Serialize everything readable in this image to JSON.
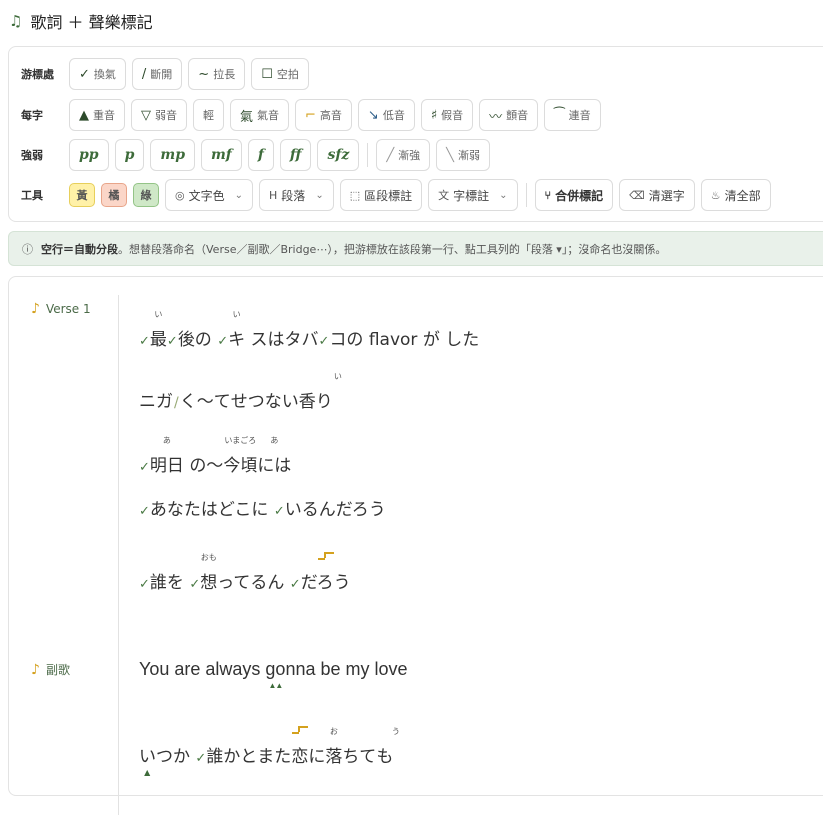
{
  "header": {
    "title": "歌詞 ＋ 聲樂標記"
  },
  "toolbar": {
    "row_breath": {
      "label": "游標處",
      "buttons": [
        {
          "glyph": "✓",
          "label": "換氣",
          "icon": "check-icon"
        },
        {
          "glyph": "/",
          "label": "斷開",
          "icon": "slash-icon"
        },
        {
          "glyph": "~",
          "label": "拉長",
          "icon": "tilde-icon"
        },
        {
          "glyph": "☐",
          "label": "空拍",
          "icon": "square-icon"
        }
      ]
    },
    "row_char": {
      "label": "每字",
      "buttons": [
        {
          "glyph": "▲",
          "label": "重音",
          "icon": "triangle-up-icon"
        },
        {
          "glyph": "▽",
          "label": "弱音",
          "icon": "triangle-down-icon"
        },
        {
          "glyph": "",
          "label": "輕",
          "icon": ""
        },
        {
          "glyph": "氣",
          "label": "氣音",
          "icon": "breath-char-icon"
        },
        {
          "glyph": "⌐",
          "label": "高音",
          "icon": "step-up-icon"
        },
        {
          "glyph": "↘",
          "label": "低音",
          "icon": "step-down-icon"
        },
        {
          "glyph": "♯",
          "label": "假音",
          "icon": "falsetto-icon"
        },
        {
          "glyph": "〰",
          "label": "顫音",
          "icon": "vibrato-icon"
        },
        {
          "glyph": "⁀",
          "label": "連音",
          "icon": "slur-icon"
        }
      ]
    },
    "row_dynamics": {
      "label": "強弱",
      "dynamics": [
        "pp",
        "p",
        "mp",
        "mf",
        "f",
        "ff",
        "sfz"
      ],
      "crescendo": {
        "glyph": "╱",
        "label": "漸強"
      },
      "decrescendo": {
        "glyph": "╲",
        "label": "漸弱"
      }
    },
    "row_tools": {
      "label": "工具",
      "chips": [
        {
          "label": "黃",
          "bg": "#fff1a8",
          "border": "#e7cf5b"
        },
        {
          "label": "橘",
          "bg": "#fbd6c8",
          "border": "#e8a58a"
        },
        {
          "label": "綠",
          "bg": "#cfe8c7",
          "border": "#94c487"
        }
      ],
      "text_color": "文字色",
      "paragraph": "段落",
      "region_mark": "區段標註",
      "char_note": "字標註",
      "merge_mark": "合併標記",
      "clear_chars": "清選字",
      "clear_all": "清全部"
    }
  },
  "info": {
    "strong": "空行＝自動分段",
    "rest": "。想替段落命名（Verse／副歌／Bridge⋯），把游標放在該段第一行、點工具列的「段落 ▾」；沒命名也沒關係。"
  },
  "lyrics": {
    "sections": [
      {
        "name": "Verse 1"
      },
      {
        "name": "副歌"
      }
    ],
    "v1_l1": {
      "c1": "最",
      "r1": "い",
      "c2": "後の",
      "c3": "キ",
      "r3": "い",
      "c4": "スはタバ",
      "c5": "コの flavor が した"
    },
    "v1_l2": {
      "a": "ニガ",
      "b": "く～てせつない",
      "c": "香り",
      "rc": "い"
    },
    "v1_l3": {
      "a": "明日",
      "ra": "あ",
      "b": "の～",
      "c": "今頃",
      "rc": "いまごろ",
      "d": "には",
      "rd": "あ"
    },
    "v1_l4": {
      "a": "あなたはどこに",
      "b": "いるんだろう"
    },
    "v1_l5": {
      "a": "誰を",
      "b": "想",
      "rb": "おも",
      "c": "ってるん",
      "d": "だろう"
    },
    "ch_l1": {
      "a": "You are always ",
      "b": "go",
      "c": "nna be my love"
    },
    "ch_l2": {
      "a": "いつか",
      "b": "誰かとまた",
      "c": "恋",
      "d": "に",
      "e": "落",
      "re": "お",
      "f": "ちて",
      "g": "も",
      "rg": "う"
    }
  },
  "colors": {
    "accent": "#3d6b3a",
    "marker": "#4a7a45",
    "gold": "#d4a11e",
    "info_bg": "#e9f1ea"
  }
}
